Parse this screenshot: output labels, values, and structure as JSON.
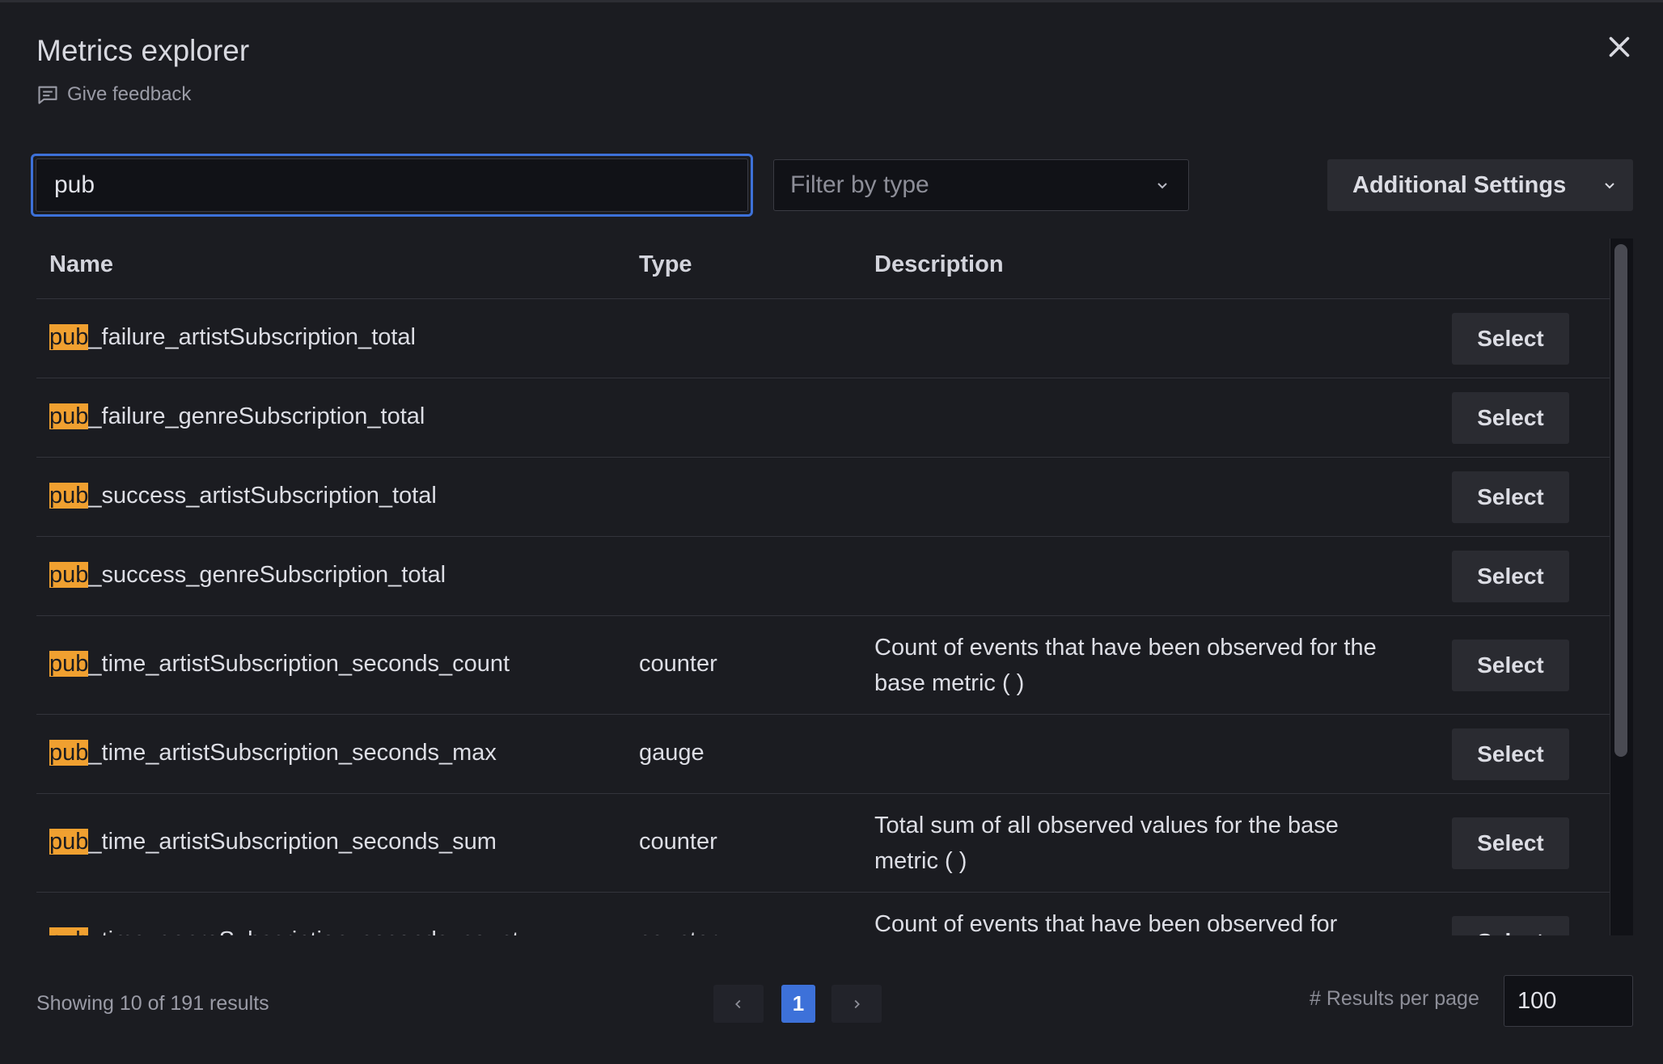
{
  "modal": {
    "title": "Metrics explorer",
    "feedback_label": "Give feedback"
  },
  "search": {
    "value": "pub",
    "placeholder": ""
  },
  "filter": {
    "placeholder": "Filter by type"
  },
  "settings": {
    "label": "Additional Settings"
  },
  "table": {
    "headers": {
      "name": "Name",
      "type": "Type",
      "description": "Description"
    },
    "rows": [
      {
        "match": "pub",
        "rest": "_failure_artistSubscription_total",
        "type": "",
        "description": "",
        "action": "Select"
      },
      {
        "match": "pub",
        "rest": "_failure_genreSubscription_total",
        "type": "",
        "description": "",
        "action": "Select"
      },
      {
        "match": "pub",
        "rest": "_success_artistSubscription_total",
        "type": "",
        "description": "",
        "action": "Select"
      },
      {
        "match": "pub",
        "rest": "_success_genreSubscription_total",
        "type": "",
        "description": "",
        "action": "Select"
      },
      {
        "match": "pub",
        "rest": "_time_artistSubscription_seconds_count",
        "type": "counter",
        "description": "Count of events that have been observed for the base metric ( )",
        "action": "Select"
      },
      {
        "match": "pub",
        "rest": "_time_artistSubscription_seconds_max",
        "type": "gauge",
        "description": "",
        "action": "Select"
      },
      {
        "match": "pub",
        "rest": "_time_artistSubscription_seconds_sum",
        "type": "counter",
        "description": "Total sum of all observed values for the base metric ( )",
        "action": "Select"
      },
      {
        "match": "pub",
        "rest": "_time_genreSubscription_seconds_count",
        "type": "counter",
        "description": "Count of events that have been observed for",
        "action": "Select"
      }
    ]
  },
  "footer": {
    "showing": "Showing 10 of 191 results",
    "current_page": "1",
    "per_page_label": "# Results per page",
    "per_page_value": "100"
  },
  "colors": {
    "background": "#1b1c21",
    "accent": "#3d71d9",
    "highlight": "#f0a030"
  }
}
